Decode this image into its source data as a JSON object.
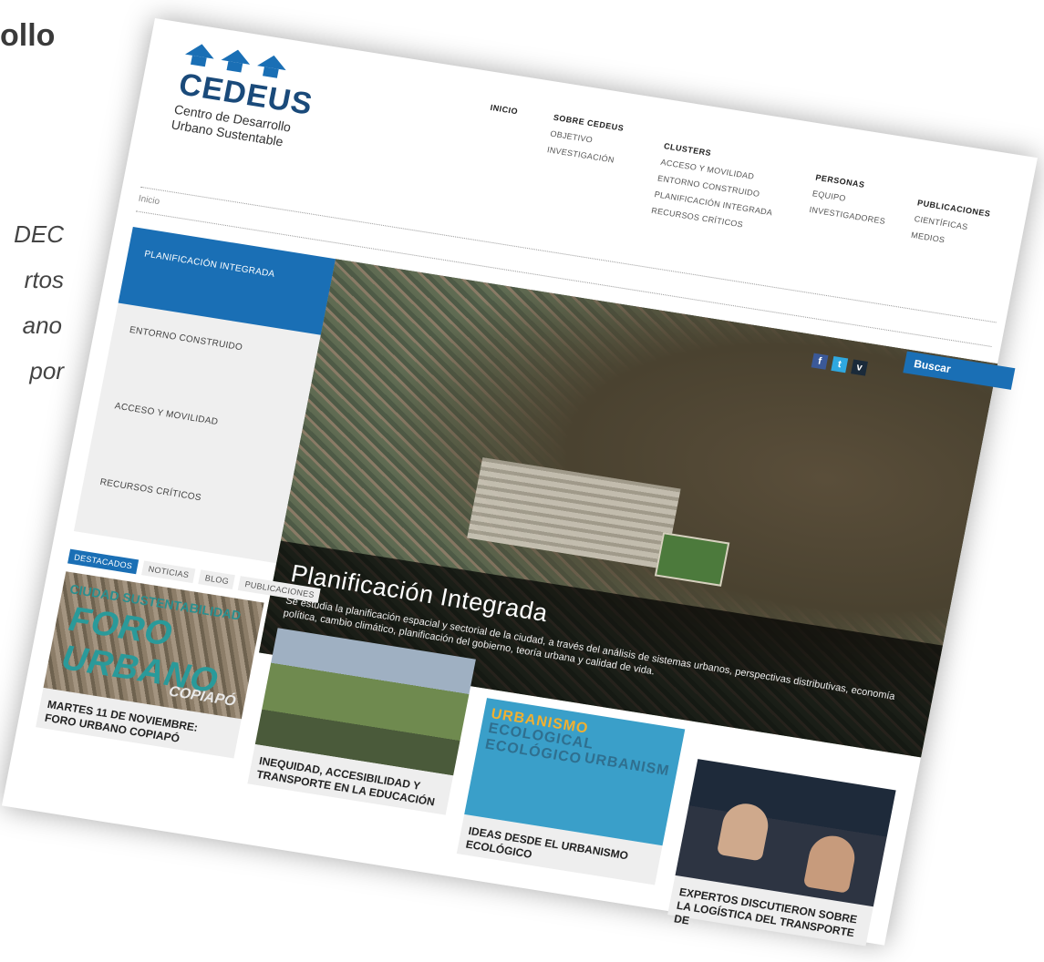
{
  "slide_fragments": {
    "title": "ollo",
    "lines": [
      "DEC",
      "rtos",
      "ano",
      "por"
    ]
  },
  "site": {
    "logo": {
      "name": "CEDEUS",
      "subtitle_line1": "Centro de Desarrollo",
      "subtitle_line2": "Urbano Sustentable"
    },
    "nav": {
      "inicio": "INICIO",
      "sobre": {
        "head": "SOBRE CEDEUS",
        "items": [
          "OBJETIVO",
          "INVESTIGACIÓN"
        ]
      },
      "clusters": {
        "head": "CLUSTERS",
        "items": [
          "ACCESO Y MOVILIDAD",
          "ENTORNO CONSTRUIDO",
          "PLANIFICACIÓN INTEGRADA",
          "RECURSOS CRÍTICOS"
        ]
      },
      "personas": {
        "head": "PERSONAS",
        "items": [
          "EQUIPO",
          "INVESTIGADORES"
        ]
      },
      "publicaciones": {
        "head": "PUBLICACIONES",
        "items": [
          "CIENTÍFICAS",
          "MEDIOS"
        ]
      }
    },
    "breadcrumb": "Inicio",
    "sidemenu": [
      "PLANIFICACIÓN INTEGRADA",
      "ENTORNO CONSTRUIDO",
      "ACCESO Y MOVILIDAD",
      "RECURSOS CRÍTICOS"
    ],
    "hero": {
      "title": "Planificación Integrada",
      "text": "Se estudia la planificación espacial y sectorial de la ciudad, a través del análisis de sistemas urbanos, perspectivas distributivas, economía política, cambio climático, planificación del gobierno, teoría urbana y calidad de vida.",
      "social": {
        "facebook": "f",
        "twitter": "t",
        "vimeo": "v"
      }
    },
    "search_label": "Buscar",
    "tabs": [
      "DESTACADOS",
      "NOTICIAS",
      "BLOG",
      "PUBLICACIONES"
    ],
    "cards": [
      {
        "title": "MARTES 11 DE NOVIEMBRE: FORO URBANO COPIAPÓ",
        "img_text": [
          "CIUDAD SUSTENTABILIDAD",
          "FORO URBANO",
          "COPIAPÓ"
        ]
      },
      {
        "title": "INEQUIDAD, ACCESIBILIDAD Y TRANSPORTE EN LA EDUCACIÓN"
      },
      {
        "title": "IDEAS DESDE EL URBANISMO ECOLÓGICO",
        "img_text": [
          "URBANISMO",
          "ECOLOGICAL ECOLÓGICO",
          "URBANISM"
        ]
      },
      {
        "title": "EXPERTOS DISCUTIERON SOBRE LA LOGÍSTICA DEL TRANSPORTE DE"
      }
    ]
  }
}
